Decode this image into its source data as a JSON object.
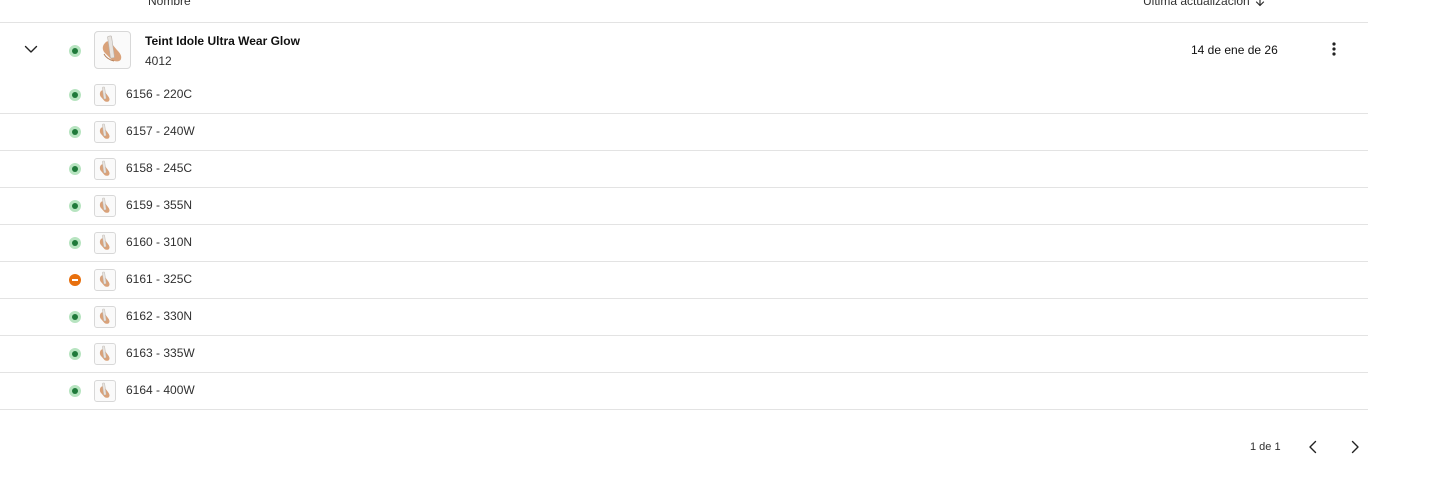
{
  "table": {
    "columns": {
      "name": "Nombre",
      "updated": "Última actualización"
    }
  },
  "product": {
    "title": "Teint Idole Ultra Wear Glow",
    "code": "4012",
    "updated": "14 de ene de 26",
    "status": "active"
  },
  "variants": [
    {
      "label": "6156 - 220C",
      "status": "active"
    },
    {
      "label": "6157 - 240W",
      "status": "active"
    },
    {
      "label": "6158 - 245C",
      "status": "active"
    },
    {
      "label": "6159 - 355N",
      "status": "active"
    },
    {
      "label": "6160 - 310N",
      "status": "active"
    },
    {
      "label": "6161 - 325C",
      "status": "inactive"
    },
    {
      "label": "6162 - 330N",
      "status": "active"
    },
    {
      "label": "6163 - 335W",
      "status": "active"
    },
    {
      "label": "6164 - 400W",
      "status": "active"
    }
  ],
  "pagination": {
    "info": "1 de 1"
  },
  "colors": {
    "status_active": "#1f7a3a",
    "status_active_ring": "#b7e4c0",
    "status_inactive": "#e8700e",
    "divider": "#e3e3e3"
  },
  "icons": {
    "expand": "chevron-down-icon",
    "sort": "arrow-down-icon",
    "more": "more-vertical-icon",
    "prev": "chevron-left-icon",
    "next": "chevron-right-icon",
    "thumbnail": "foundation-bottle-image"
  }
}
